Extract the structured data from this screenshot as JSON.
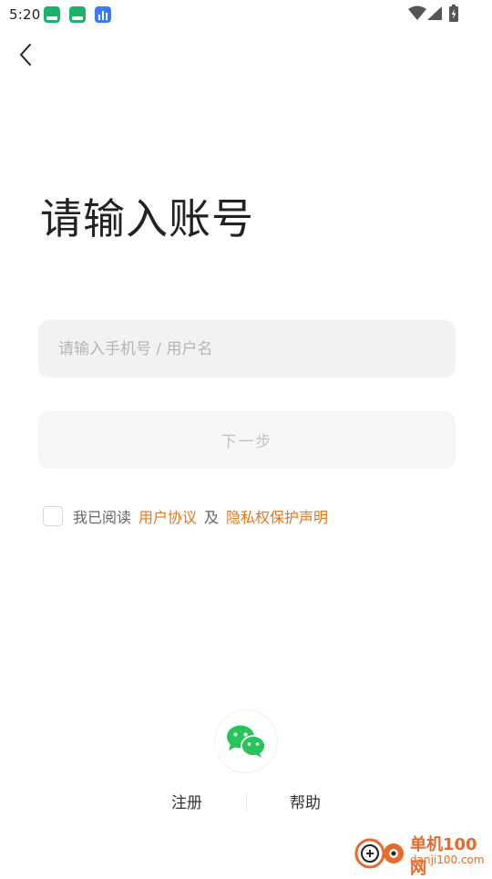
{
  "status_bar": {
    "time": "5:20",
    "notification_icons": [
      "app-green-icon",
      "app-green-icon",
      "app-blue-icon"
    ]
  },
  "header": {
    "back_icon": "chevron-left-icon"
  },
  "login": {
    "title": "请输入账号",
    "account_placeholder": "请输入手机号 / 用户名",
    "account_value": "",
    "next_label": "下一步"
  },
  "agreement": {
    "prefix": "我已阅读",
    "user_agreement": "用户协议",
    "conjunction": "及",
    "privacy_policy": "隐私权保护声明",
    "checked": false
  },
  "footer": {
    "register_label": "注册",
    "help_label": "帮助"
  },
  "watermark": {
    "name_cn": "单机100网",
    "domain": "danji100.com"
  },
  "colors": {
    "accent": "#e6771a",
    "wechat": "#27c45a",
    "input_bg": "#f2f2f2",
    "button_bg": "#f6f6f6"
  }
}
